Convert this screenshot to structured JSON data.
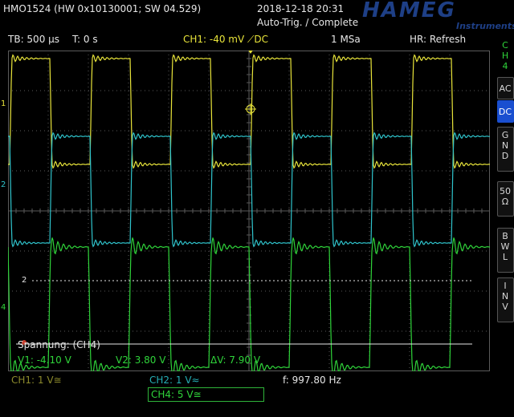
{
  "header": {
    "device_id": "HMO1524 (HW 0x10130001; SW 04.529)",
    "datetime": "2018-12-18 20:31",
    "trigger_status": "Auto-Trig. / Complete",
    "brand": "HAMEG",
    "brand_sub": "Instruments"
  },
  "infobar": {
    "timebase": "TB: 500 µs",
    "time_offset": "T: 0 s",
    "ch1_trigger": "CH1: -40 mV ⟋DC",
    "sample_rate": "1 MSa",
    "hr_mode": "HR: Refresh"
  },
  "rightbar": {
    "channel": [
      "C",
      "H",
      "4"
    ],
    "ac": "AC",
    "dc": "DC",
    "gnd": [
      "G",
      "N",
      "D"
    ],
    "ohm": [
      "50",
      "Ω"
    ],
    "bwl": [
      "B",
      "W",
      "L"
    ],
    "inv": [
      "I",
      "N",
      "V"
    ]
  },
  "markers": {
    "ch1": "1",
    "ch2": "2",
    "ch4": "4",
    "ref2": "2"
  },
  "cursor": {
    "title": "Spannung: (CH4)",
    "v1": "V1: -4.10 V",
    "v2": "V2: 3.80 V",
    "dv": "ΔV: 7.90 V"
  },
  "bottombar": {
    "ch1": "CH1: 1 V≅",
    "ch2": "CH2: 1 V≈",
    "ch4": "CH4: 5 V≅",
    "frequency": "f: 997.80 Hz"
  },
  "colors": {
    "ch1": "#e8e43a",
    "ch2": "#2fc4cc",
    "ch4": "#2fd43a",
    "grid": "#5a5a5a",
    "brand": "#1e3f86"
  }
}
